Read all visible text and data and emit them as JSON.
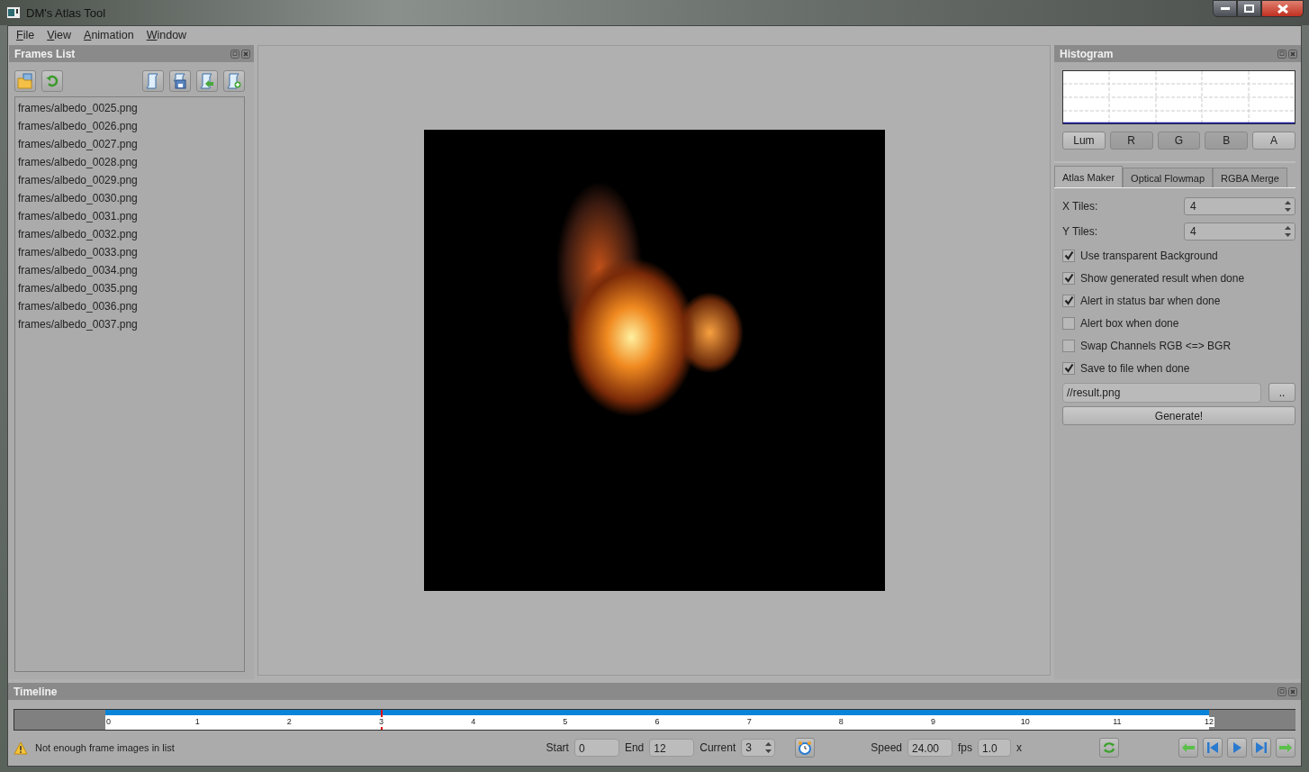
{
  "window": {
    "title": "DM's Atlas Tool"
  },
  "menu": [
    "File",
    "View",
    "Animation",
    "Window"
  ],
  "frames_panel": {
    "title": "Frames List",
    "items": [
      "frames/albedo_0025.png",
      "frames/albedo_0026.png",
      "frames/albedo_0027.png",
      "frames/albedo_0028.png",
      "frames/albedo_0029.png",
      "frames/albedo_0030.png",
      "frames/albedo_0031.png",
      "frames/albedo_0032.png",
      "frames/albedo_0033.png",
      "frames/albedo_0034.png",
      "frames/albedo_0035.png",
      "frames/albedo_0036.png",
      "frames/albedo_0037.png"
    ]
  },
  "histogram": {
    "title": "Histogram",
    "channels": [
      {
        "label": "Lum",
        "selected": false
      },
      {
        "label": "R",
        "selected": true
      },
      {
        "label": "G",
        "selected": true
      },
      {
        "label": "B",
        "selected": true
      },
      {
        "label": "A",
        "selected": false
      }
    ]
  },
  "tabs": [
    {
      "label": "Atlas Maker",
      "selected": true
    },
    {
      "label": "Optical Flowmap",
      "selected": false
    },
    {
      "label": "RGBA Merge",
      "selected": false
    }
  ],
  "atlas": {
    "spinners": [
      {
        "label": "X Tiles:",
        "value": "4"
      },
      {
        "label": "Y Tiles:",
        "value": "4"
      }
    ],
    "options": [
      {
        "label": "Use transparent Background",
        "checked": true
      },
      {
        "label": "Show generated result when done",
        "checked": true
      },
      {
        "label": "Alert in status bar when done",
        "checked": true
      },
      {
        "label": "Alert box when done",
        "checked": false
      },
      {
        "label": "Swap Channels  RGB <=> BGR",
        "checked": false
      },
      {
        "label": "Save to file when done",
        "checked": true
      }
    ],
    "output_path": "//result.png",
    "browse_button": "..",
    "generate_button": "Generate!"
  },
  "timeline": {
    "title": "Timeline",
    "ticks": [
      "0",
      "1",
      "2",
      "3",
      "4",
      "5",
      "6",
      "7",
      "8",
      "9",
      "10",
      "11",
      "12"
    ],
    "level": 0.25,
    "status": "Not enough frame images in list",
    "start": {
      "label": "Start",
      "value": "0"
    },
    "end": {
      "label": "End",
      "value": "12"
    },
    "current": {
      "label": "Current",
      "value": "3"
    },
    "speed": {
      "label": "Speed",
      "value": "24.00",
      "unit": "fps"
    },
    "multiplier": {
      "value": "1.0",
      "unit": "x"
    }
  }
}
